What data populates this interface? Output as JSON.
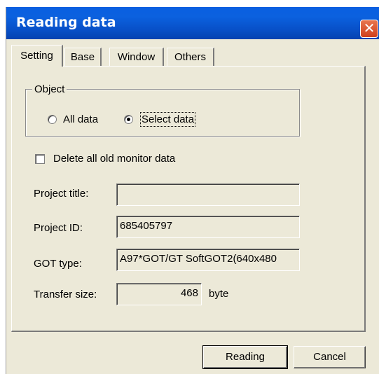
{
  "window": {
    "title": "Reading data",
    "close_glyph": "✕"
  },
  "tabs": [
    {
      "label": "Setting",
      "active": true
    },
    {
      "label": "Base",
      "active": false
    },
    {
      "label": "Window",
      "active": false
    },
    {
      "label": "Others",
      "active": false
    }
  ],
  "object_group": {
    "legend": "Object",
    "options": [
      {
        "label": "All data",
        "selected": false
      },
      {
        "label": "Select data",
        "selected": true
      }
    ]
  },
  "delete_old": {
    "label": "Delete all old monitor data",
    "checked": false
  },
  "fields": {
    "project_title": {
      "label": "Project title:",
      "value": ""
    },
    "project_id": {
      "label": "Project ID:",
      "value": "685405797"
    },
    "got_type": {
      "label": "GOT type:",
      "value": "A97*GOT/GT SoftGOT2(640x480"
    },
    "transfer_size": {
      "label": "Transfer size:",
      "value": "468",
      "unit": "byte"
    }
  },
  "buttons": {
    "reading": "Reading",
    "cancel": "Cancel"
  },
  "colors": {
    "titlebar": "#0a5fe0",
    "dialog_bg": "#ece9d8",
    "close": "#cf3f1c"
  }
}
